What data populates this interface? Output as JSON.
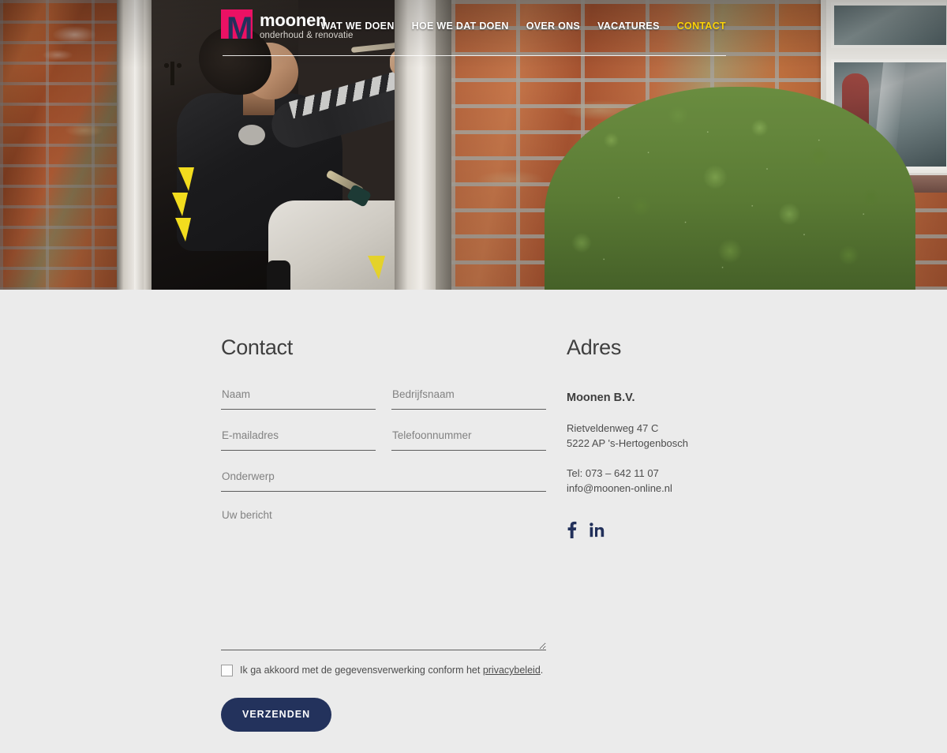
{
  "site": {
    "logo": {
      "mark_letter": "M",
      "name": "moonen",
      "tagline": "onderhoud & renovatie",
      "square_color": "#ec1164",
      "letter_color": "#24305c"
    },
    "nav": {
      "items": [
        {
          "label": "WAT WE DOEN",
          "active": false
        },
        {
          "label": "HOE WE DAT DOEN",
          "active": false
        },
        {
          "label": "OVER ONS",
          "active": false
        },
        {
          "label": "VACATURES",
          "active": false
        },
        {
          "label": "CONTACT",
          "active": true
        }
      ],
      "active_color": "#fbd307",
      "inactive_color": "#ffffff"
    }
  },
  "hero": {
    "description": "Photo of a painter in dark work jacket kneeling in a doorway painting a door frame with a roller, brick wall and green shrub beside a white window frame"
  },
  "contact": {
    "heading": "Contact",
    "fields": {
      "naam": {
        "placeholder": "Naam",
        "value": ""
      },
      "bedrijfsnaam": {
        "placeholder": "Bedrijfsnaam",
        "value": ""
      },
      "email": {
        "placeholder": "E-mailadres",
        "value": ""
      },
      "telefoon": {
        "placeholder": "Telefoonnummer",
        "value": ""
      },
      "onderwerp": {
        "placeholder": "Onderwerp",
        "value": ""
      },
      "bericht": {
        "placeholder": "Uw bericht",
        "value": ""
      }
    },
    "consent": {
      "text_before": "Ik ga akkoord met de gegevensverwerking conform het ",
      "link_label": "privacybeleid",
      "text_after": "."
    },
    "submit_label": "VERZENDEN",
    "submit_color": "#23325c"
  },
  "address": {
    "heading": "Adres",
    "company": "Moonen B.V.",
    "street": "Rietveldenweg 47 C",
    "city": "5222 AP 's-Hertogenbosch",
    "phone": "Tel: 073 – 642 11 07",
    "email": "info@moonen-online.nl",
    "socials": [
      {
        "name": "facebook",
        "label": "f"
      },
      {
        "name": "linkedin",
        "label": "in"
      }
    ],
    "social_color": "#22305a"
  }
}
